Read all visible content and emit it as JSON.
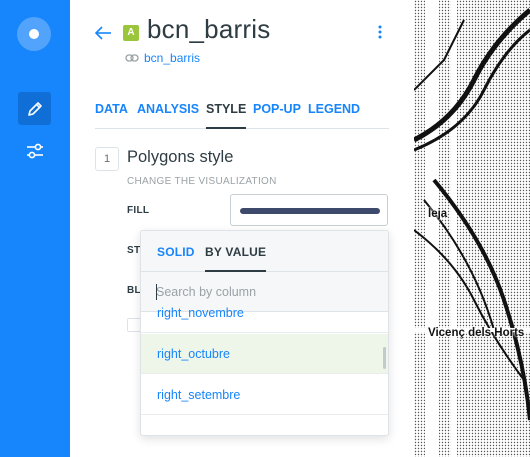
{
  "layer": {
    "badge": "A",
    "title": "bcn_barris",
    "source": "bcn_barris"
  },
  "tabs": [
    "DATA",
    "ANALYSIS",
    "STYLE",
    "POP-UP",
    "LEGEND"
  ],
  "active_tab": "STYLE",
  "section": {
    "number": "1",
    "title": "Polygons style",
    "subtitle": "CHANGE THE VISUALIZATION"
  },
  "rows": {
    "fill": "FILL",
    "stroke_partial": "ST",
    "blending_partial": "BL"
  },
  "colors": {
    "accent": "#1785FB",
    "fill_color": "#3E4A6B",
    "layer_badge": "#9BC63B",
    "selected_row_bg": "#EEF6EA"
  },
  "dropdown": {
    "tabs": [
      "SOLID",
      "BY VALUE"
    ],
    "active_tab": "BY VALUE",
    "search_placeholder": "Search by column",
    "items": [
      "right_novembre",
      "right_octubre",
      "right_setembre"
    ],
    "selected_item": "right_octubre"
  },
  "map": {
    "labels": [
      "leja",
      "Vicenç dels Horts"
    ]
  }
}
